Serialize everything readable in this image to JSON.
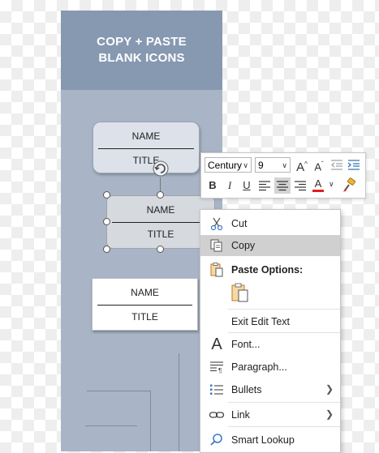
{
  "slide": {
    "header_line1": "COPY + PASTE",
    "header_line2": "BLANK ICONS",
    "cards": [
      {
        "name": "NAME",
        "title": "TITLE"
      },
      {
        "name": "NAME",
        "title": "TITLE"
      },
      {
        "name": "NAME",
        "title": "TITLE"
      }
    ]
  },
  "mini_toolbar": {
    "font_value": "Century",
    "size_value": "9",
    "grow_font_glyph": "A",
    "shrink_font_glyph": "A",
    "bold_glyph": "B",
    "italic_glyph": "I",
    "underline_glyph": "U",
    "font_color_glyph": "A",
    "font_color_accent": "#e0201b"
  },
  "context_menu": {
    "cut": "Cut",
    "copy": "Copy",
    "paste_options": "Paste Options:",
    "exit_edit_text": "Exit Edit Text",
    "font": "Font...",
    "paragraph": "Paragraph...",
    "bullets": "Bullets",
    "link": "Link",
    "smart_lookup": "Smart Lookup"
  },
  "colors": {
    "slide_bg": "#a9b5c6",
    "slide_header": "#8798b1",
    "menu_highlight": "#d0d0d0",
    "paste_icon": "#c07a1a"
  }
}
